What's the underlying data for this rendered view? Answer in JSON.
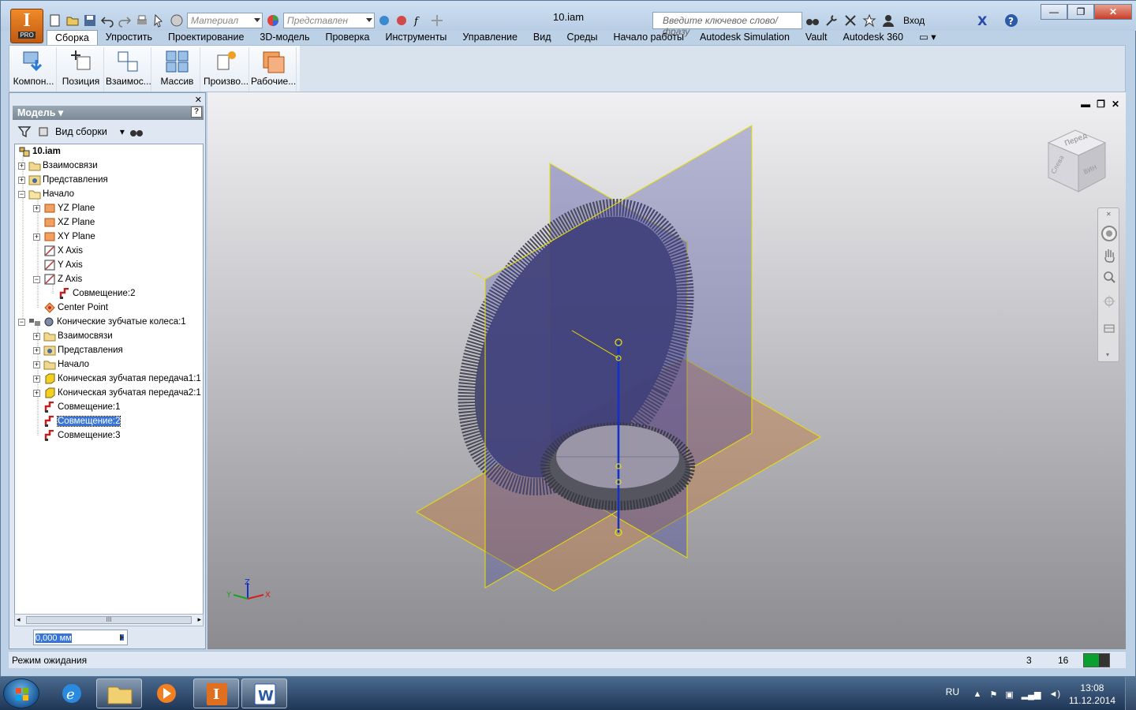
{
  "app": {
    "logo_letter": "I",
    "logo_badge": "PRO",
    "document_title": "10.iam",
    "material_placeholder": "Материал",
    "representation_placeholder": "Представлен",
    "search_placeholder": "Введите ключевое слово/фразу",
    "login_label": "Вход"
  },
  "menu": {
    "tabs": [
      "Сборка",
      "Упростить",
      "Проектирование",
      "3D-модель",
      "Проверка",
      "Инструменты",
      "Управление",
      "Вид",
      "Среды",
      "Начало работы",
      "Autodesk Simulation",
      "Vault",
      "Autodesk 360"
    ]
  },
  "ribbon": {
    "buttons": [
      "Компон...",
      "Позиция",
      "Взаимос...",
      "Массив",
      "Произво...",
      "Рабочие..."
    ]
  },
  "browser": {
    "title": "Модель",
    "view_label": "Вид сборки",
    "nodes": [
      {
        "label": "10.iam"
      },
      {
        "label": "Взаимосвязи"
      },
      {
        "label": "Представления"
      },
      {
        "label": "Начало"
      },
      {
        "label": "YZ Plane"
      },
      {
        "label": "XZ Plane"
      },
      {
        "label": "XY Plane"
      },
      {
        "label": "X Axis"
      },
      {
        "label": "Y Axis"
      },
      {
        "label": "Z Axis"
      },
      {
        "label": "Совмещение:2"
      },
      {
        "label": "Center Point"
      },
      {
        "label": "Конические зубчатые колеса:1"
      },
      {
        "label": "Взаимосвязи"
      },
      {
        "label": "Представления"
      },
      {
        "label": "Начало"
      },
      {
        "label": "Коническая зубчатая передача1:1"
      },
      {
        "label": "Коническая зубчатая передача2:1"
      },
      {
        "label": "Совмещение:1"
      },
      {
        "label": "Совмещение:2"
      },
      {
        "label": "Совмещение:3"
      }
    ],
    "value_field": "0,000 мм",
    "scroll_thumb": "III"
  },
  "viewcube": {
    "face_top": "Перед",
    "face_left": "Слева",
    "face_right": "ВИН"
  },
  "triad": {
    "x": "X",
    "y": "Y",
    "z": "Z"
  },
  "status": {
    "text": "Режим ожидания",
    "count1": "3",
    "count2": "16"
  },
  "taskbar": {
    "lang": "RU",
    "time": "13:08",
    "date": "11.12.2014"
  },
  "colors": {
    "plane_yellow": "#e8e000",
    "plane_fill": "#3a3a9a",
    "xy_plane_fill": "#c07840",
    "axis_blue": "#1030d0",
    "selection": "#3875d7"
  }
}
